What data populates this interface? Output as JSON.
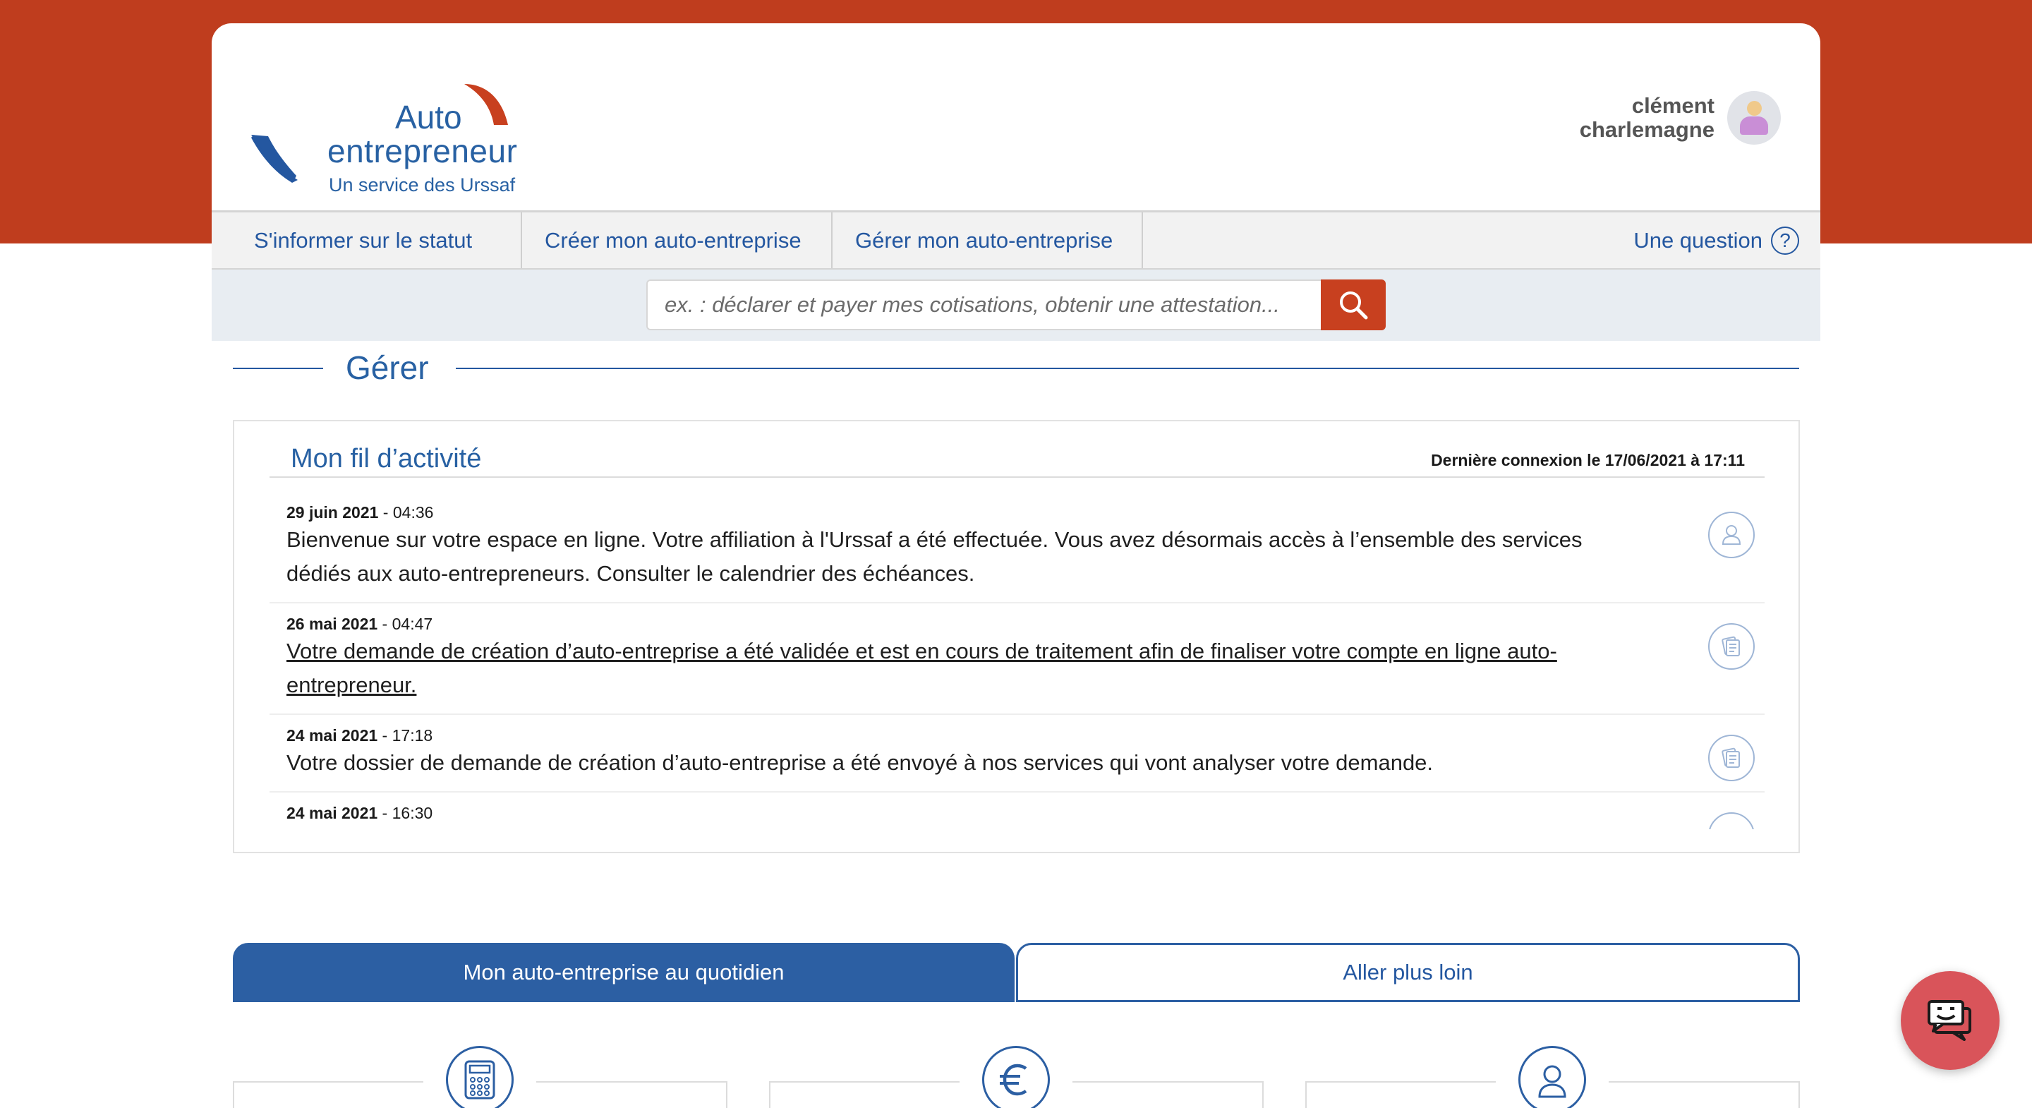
{
  "brand": {
    "logo_line1": "Auto",
    "logo_line2": "entrepreneur",
    "logo_tagline": "Un service des Urssaf",
    "color_primary": "#2861a3",
    "color_accent": "#bf3d1e"
  },
  "user": {
    "first_name": "clément",
    "last_name": "charlemagne"
  },
  "nav": {
    "items": [
      {
        "label": "S'informer sur le statut"
      },
      {
        "label": "Créer mon auto-entreprise"
      },
      {
        "label": "Gérer mon auto-entreprise"
      }
    ],
    "question_label": "Une question",
    "question_icon": "?"
  },
  "search": {
    "placeholder": "ex. : déclarer et payer mes cotisations, obtenir une attestation...",
    "button_icon": "search-icon"
  },
  "section": {
    "title": "Gérer"
  },
  "activity": {
    "title": "Mon fil d’activité",
    "last_connection": "Dernière connexion le 17/06/2021 à 17:11",
    "entries": [
      {
        "date": "29 juin 2021",
        "time": " - 04:36",
        "text": "Bienvenue sur votre espace en ligne. Votre affiliation à l'Urssaf a été effectuée. Vous avez désormais accès à l’ensemble des services dédiés aux auto-entrepreneurs. Consulter le calendrier des échéances.",
        "icon": "user-icon",
        "is_link": false
      },
      {
        "date": "26 mai 2021",
        "time": " - 04:47",
        "text": "Votre demande de création d’auto-entreprise a été validée et est en cours de traitement afin de finaliser votre compte en ligne auto-entrepreneur.",
        "icon": "document-icon",
        "is_link": true
      },
      {
        "date": "24 mai 2021",
        "time": " - 17:18",
        "text": "Votre dossier de demande de création d’auto-entreprise a été envoyé à nos services qui vont analyser votre demande.",
        "icon": "document-icon",
        "is_link": false
      },
      {
        "date": "24 mai 2021",
        "time": " - 16:30",
        "text": "",
        "icon": "user-icon",
        "is_link": false
      }
    ]
  },
  "tabs": {
    "active_label": "Mon auto-entreprise au quotidien",
    "inactive_label": "Aller plus loin"
  },
  "features": [
    {
      "icon": "calculator-icon"
    },
    {
      "icon": "euro-icon"
    },
    {
      "icon": "user-icon"
    }
  ],
  "chat": {
    "icon": "chat-icon"
  }
}
